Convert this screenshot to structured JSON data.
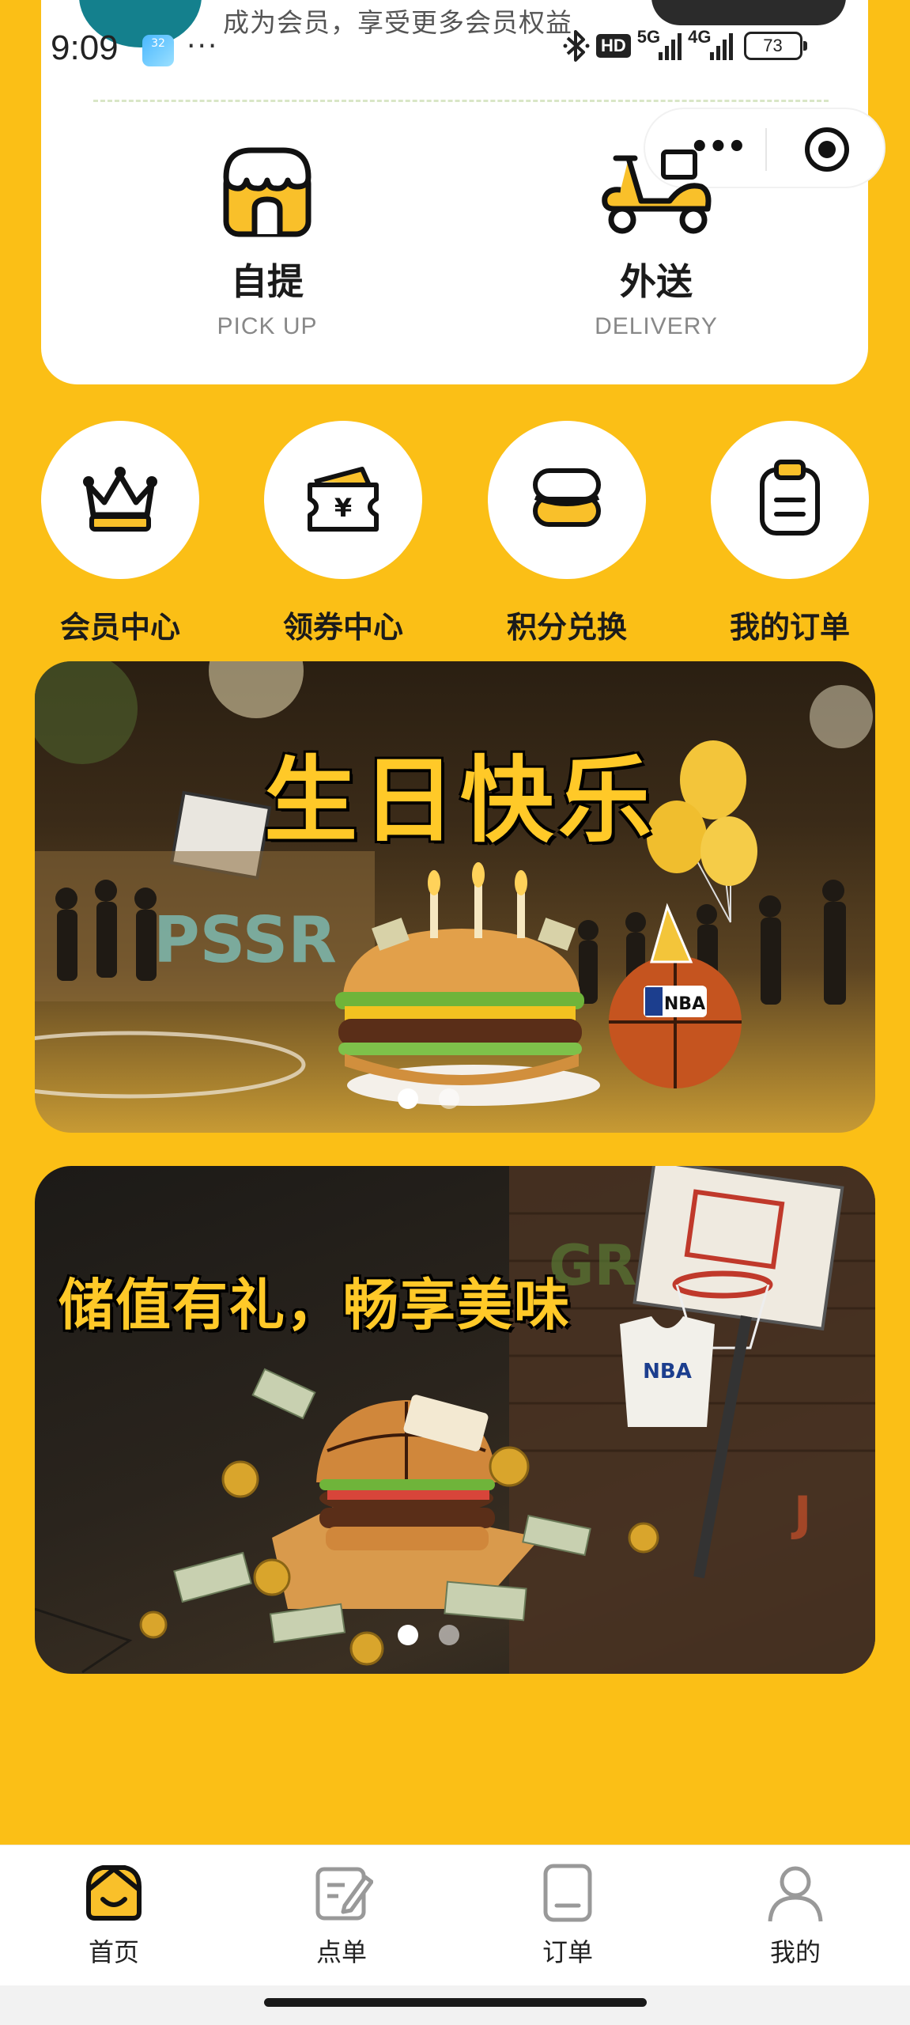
{
  "status_bar": {
    "time": "9:09",
    "app_badge": "32",
    "dots": "···",
    "hd": "HD",
    "net1": "5G",
    "net2": "4G",
    "battery": "73"
  },
  "member_banner": {
    "text": "成为会员，享受更多会员权益"
  },
  "services": {
    "pickup": {
      "title": "自提",
      "subtitle": "PICK UP",
      "icon": "shop-icon"
    },
    "delivery": {
      "title": "外送",
      "subtitle": "DELIVERY",
      "icon": "scooter-icon"
    }
  },
  "quick_actions": [
    {
      "label": "会员中心",
      "icon": "crown-icon"
    },
    {
      "label": "领券中心",
      "icon": "coupon-icon"
    },
    {
      "label": "积分兑换",
      "icon": "coins-icon"
    },
    {
      "label": "我的订单",
      "icon": "clipboard-icon"
    }
  ],
  "banners": [
    {
      "title": "生日快乐",
      "ball_text": "NBA",
      "active_dot": 0,
      "dot_count": 2
    },
    {
      "title": "储值有礼，畅享美味",
      "jersey_text": "NBA",
      "active_dot": 0,
      "dot_count": 2
    }
  ],
  "tabbar": {
    "items": [
      {
        "label": "首页",
        "icon": "home-icon",
        "active": true
      },
      {
        "label": "点单",
        "icon": "menu-edit-icon",
        "active": false
      },
      {
        "label": "订单",
        "icon": "order-icon",
        "active": false
      },
      {
        "label": "我的",
        "icon": "user-icon",
        "active": false
      }
    ]
  },
  "colors": {
    "brand_yellow": "#FBBF16",
    "accent_yellow": "#F9C02A",
    "ink": "#1B1B1B",
    "white": "#FFFFFF"
  }
}
